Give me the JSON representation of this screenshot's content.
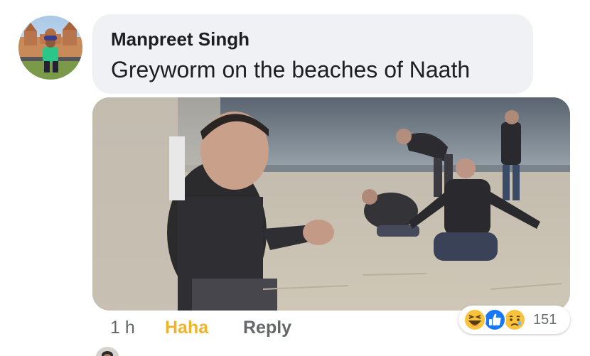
{
  "comment": {
    "author": "Manpreet Singh",
    "text": "Greyworm on the beaches of Naath"
  },
  "actions": {
    "time": "1 h",
    "reaction_selected": "Haha",
    "reply": "Reply"
  },
  "reactions": {
    "icons": [
      "haha-icon",
      "like-icon",
      "sad-icon"
    ],
    "count": "151"
  },
  "colors": {
    "bubble": "#eff1f4",
    "haha_accent": "#f0b429",
    "like_blue": "#1877f2",
    "muted_text": "#65676b"
  }
}
